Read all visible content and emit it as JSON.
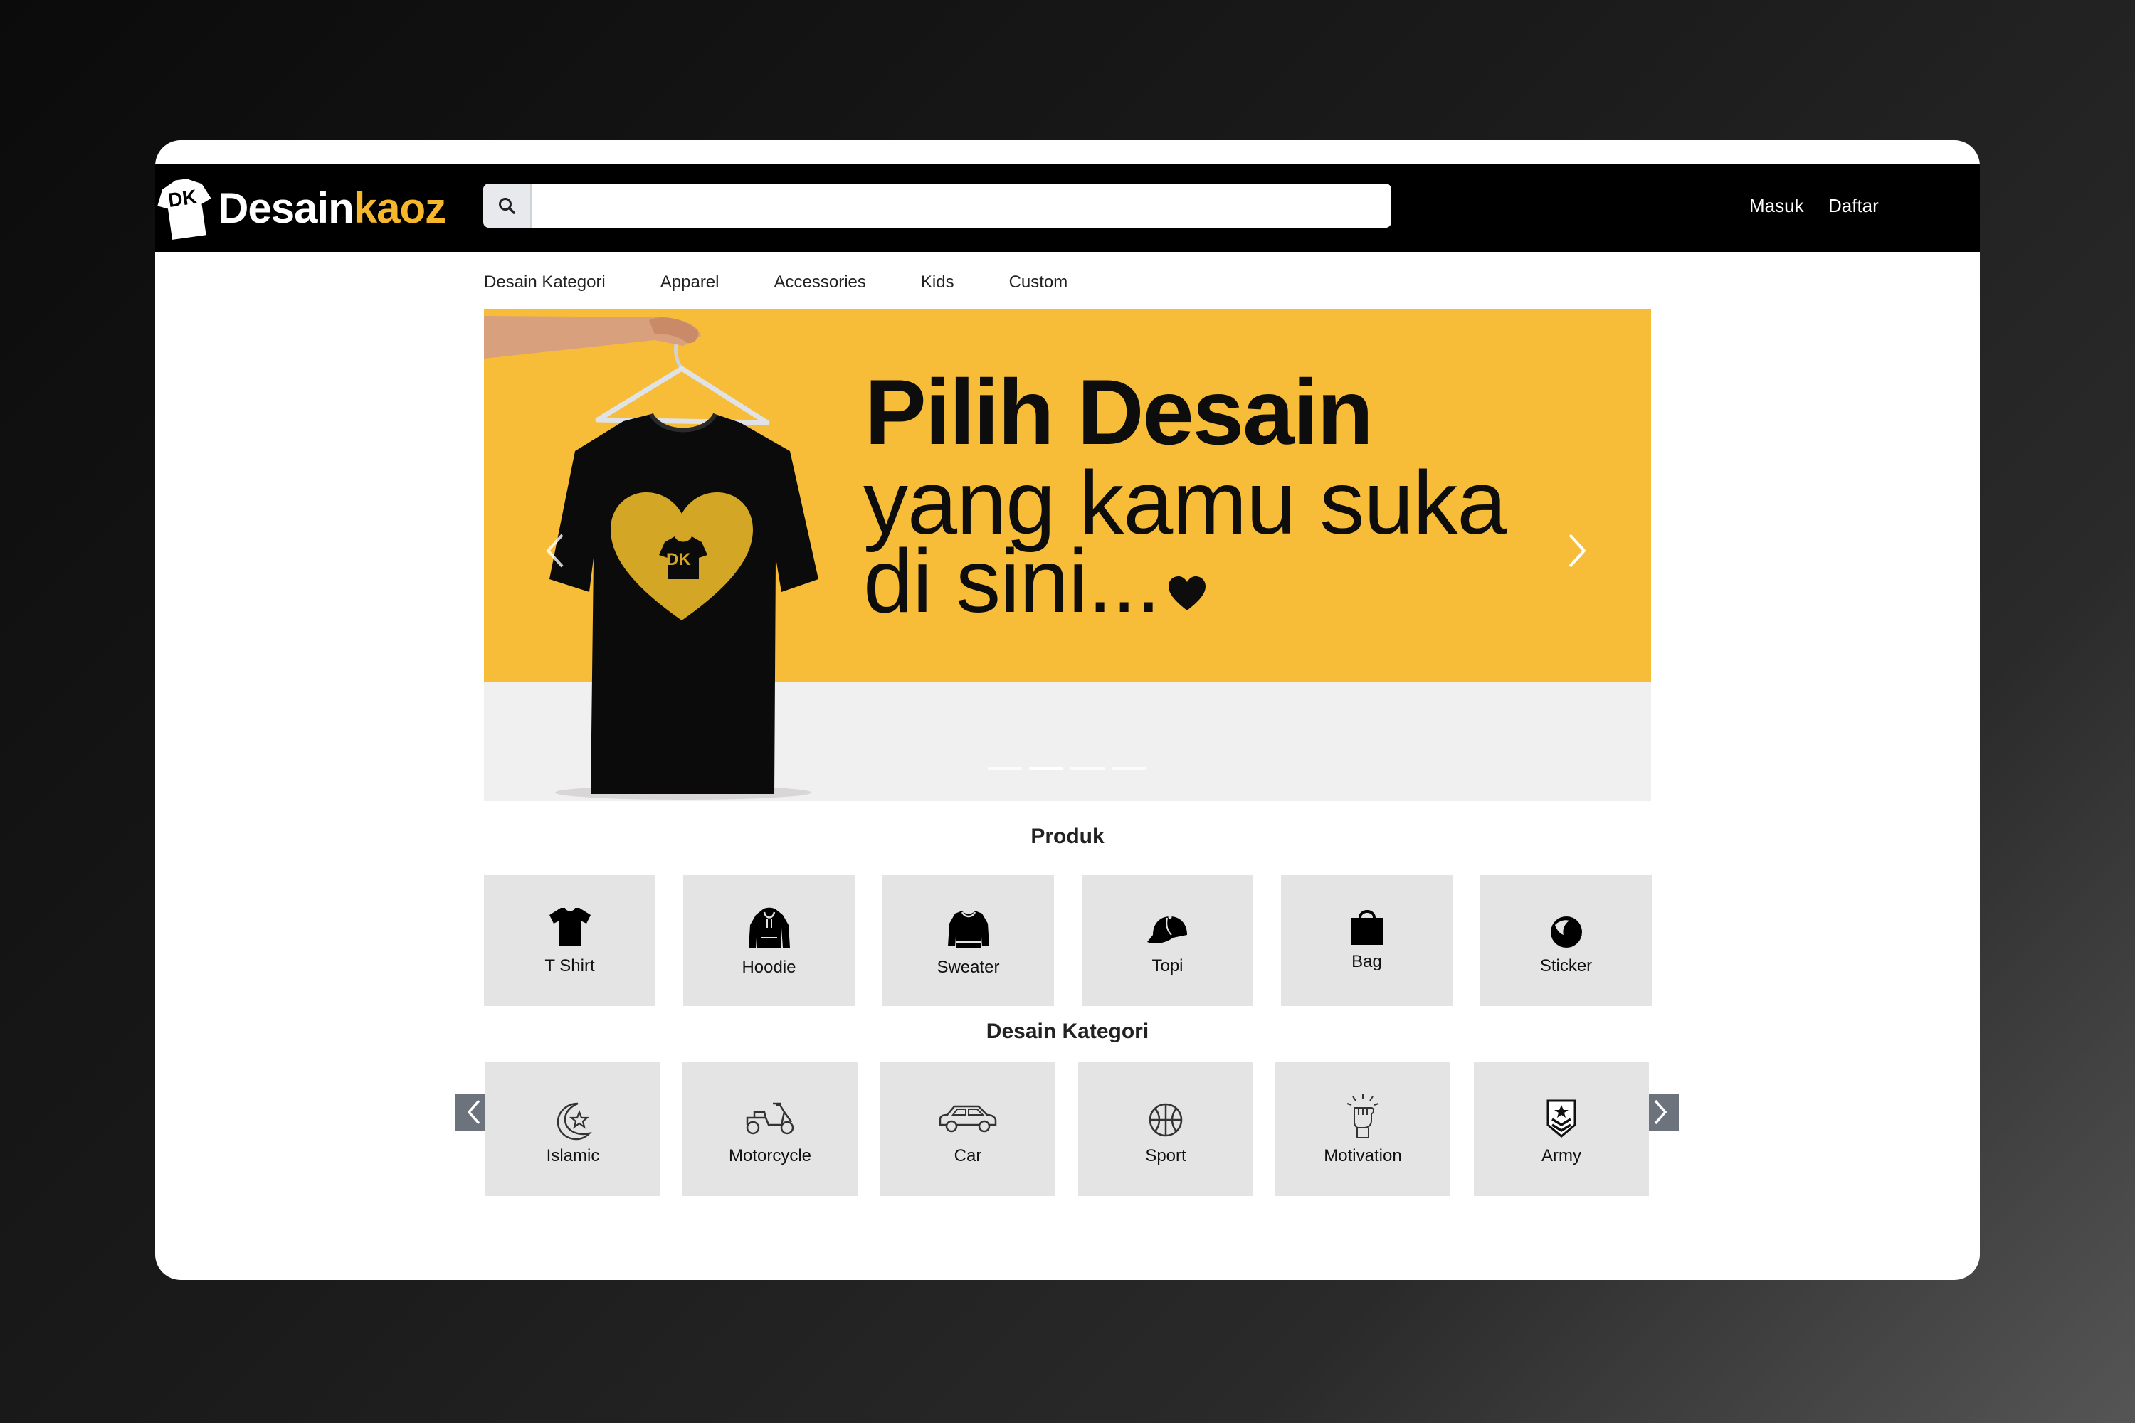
{
  "header": {
    "logo_text_main": "Desain",
    "logo_text_accent": "kaoz",
    "logo_mark": "DK",
    "search_placeholder": "",
    "login_label": "Masuk",
    "register_label": "Daftar"
  },
  "nav": {
    "items": [
      "Desain Kategori",
      "Apparel",
      "Accessories",
      "Kids",
      "Custom"
    ]
  },
  "banner": {
    "headline_bold": "Pilih Desain",
    "headline_line2": "yang kamu suka",
    "headline_line3": "di sini...",
    "shirt_logo": "DK",
    "slide_count": 4,
    "active_slide": 2,
    "colors": {
      "background": "#f7bd38",
      "text": "#0d0d0d"
    }
  },
  "produk": {
    "title": "Produk",
    "items": [
      {
        "label": "T Shirt",
        "icon": "tshirt-icon"
      },
      {
        "label": "Hoodie",
        "icon": "hoodie-icon"
      },
      {
        "label": "Sweater",
        "icon": "sweater-icon"
      },
      {
        "label": "Topi",
        "icon": "cap-icon"
      },
      {
        "label": "Bag",
        "icon": "bag-icon"
      },
      {
        "label": "Sticker",
        "icon": "sticker-icon"
      }
    ]
  },
  "kategori": {
    "title": "Desain Kategori",
    "items": [
      {
        "label": "Islamic",
        "icon": "crescent-star-icon"
      },
      {
        "label": "Motorcycle",
        "icon": "scooter-icon"
      },
      {
        "label": "Car",
        "icon": "car-icon"
      },
      {
        "label": "Sport",
        "icon": "basketball-icon"
      },
      {
        "label": "Motivation",
        "icon": "raised-fist-icon"
      },
      {
        "label": "Army",
        "icon": "army-badge-icon"
      }
    ]
  },
  "colors": {
    "header_bg": "#000000",
    "accent": "#f6b82a",
    "tile_bg": "#e4e4e4",
    "arrow_bg": "#6c737c"
  }
}
